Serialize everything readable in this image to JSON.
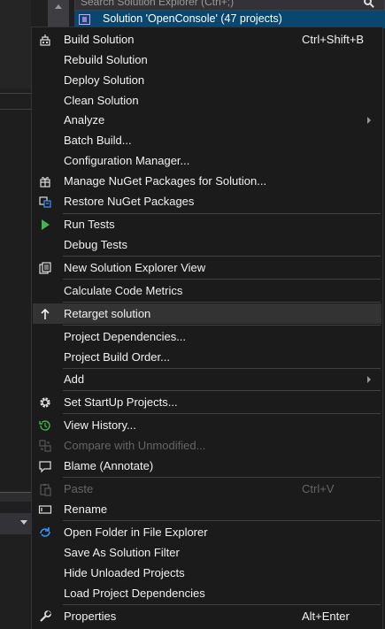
{
  "solution_explorer": {
    "search_placeholder": "Search Solution Explorer (Ctrl+;)",
    "solution_label": "Solution 'OpenConsole' (47 projects)"
  },
  "colors": {
    "menu_background": "#1b1b1c",
    "selection": "#094771",
    "hover": "#333334",
    "separator": "#3f3f46",
    "disabled_text": "#656565",
    "green_run": "#3fb64e",
    "blue_folder": "#3794ff"
  },
  "menu": {
    "items": [
      {
        "label": "Build Solution",
        "shortcut": "Ctrl+Shift+B",
        "icon": "build-icon"
      },
      {
        "label": "Rebuild Solution"
      },
      {
        "label": "Deploy Solution"
      },
      {
        "label": "Clean Solution"
      },
      {
        "label": "Analyze",
        "submenu": true
      },
      {
        "label": "Batch Build..."
      },
      {
        "label": "Configuration Manager..."
      },
      {
        "label": "Manage NuGet Packages for Solution...",
        "icon": "nuget-package-icon"
      },
      {
        "label": "Restore NuGet Packages",
        "icon": "restore-packages-icon"
      },
      {
        "label": "Run Tests",
        "icon": "run-tests-icon"
      },
      {
        "label": "Debug Tests"
      },
      {
        "label": "New Solution Explorer View",
        "icon": "new-explorer-view-icon"
      },
      {
        "label": "Calculate Code Metrics"
      },
      {
        "label": "Retarget solution",
        "icon": "retarget-arrow-icon",
        "highlighted": true
      },
      {
        "label": "Project Dependencies..."
      },
      {
        "label": "Project Build Order..."
      },
      {
        "label": "Add",
        "submenu": true
      },
      {
        "label": "Set StartUp Projects...",
        "icon": "gear-icon"
      },
      {
        "label": "View History...",
        "icon": "history-icon"
      },
      {
        "label": "Compare with Unmodified...",
        "icon": "compare-icon",
        "disabled": true
      },
      {
        "label": "Blame (Annotate)",
        "icon": "blame-comment-icon"
      },
      {
        "label": "Paste",
        "shortcut": "Ctrl+V",
        "icon": "paste-icon",
        "disabled": true
      },
      {
        "label": "Rename",
        "icon": "rename-icon"
      },
      {
        "label": "Open Folder in File Explorer",
        "icon": "open-folder-icon"
      },
      {
        "label": "Save As Solution Filter"
      },
      {
        "label": "Hide Unloaded Projects"
      },
      {
        "label": "Load Project Dependencies"
      },
      {
        "label": "Properties",
        "shortcut": "Alt+Enter",
        "icon": "wrench-icon"
      }
    ]
  }
}
